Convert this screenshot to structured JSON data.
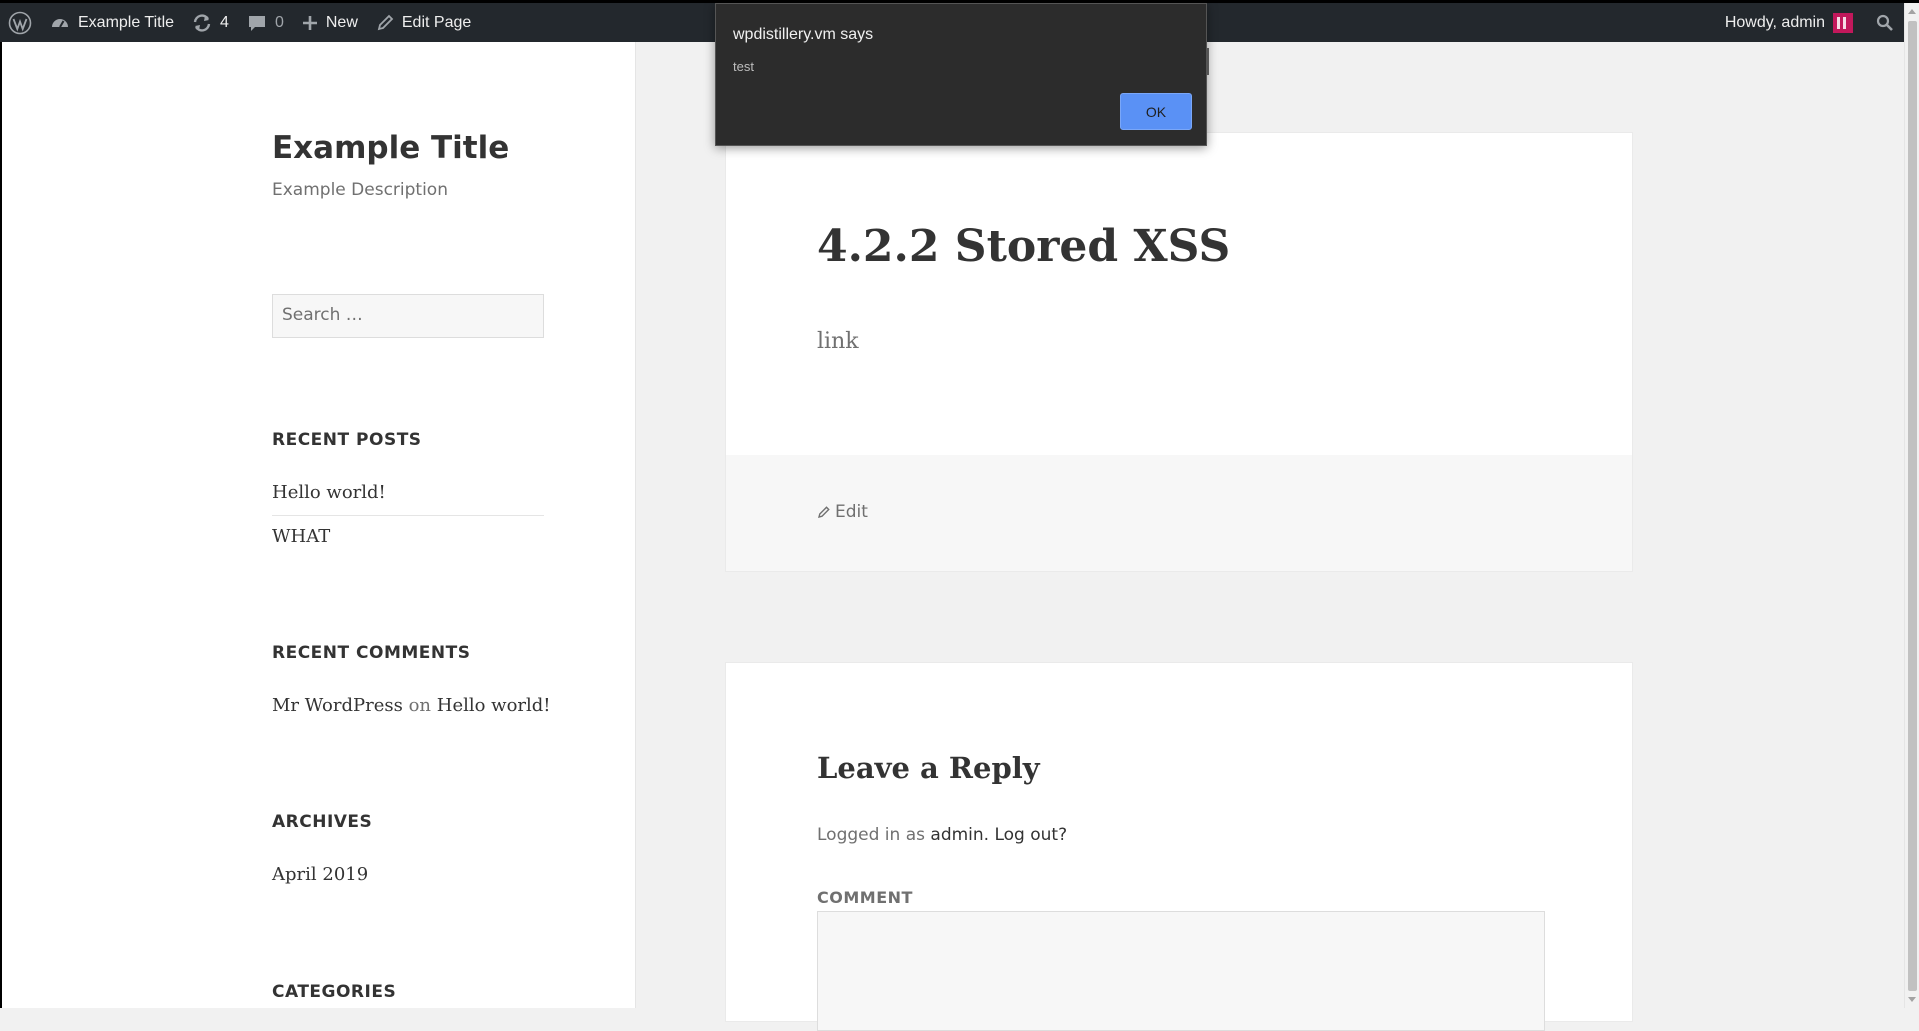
{
  "adminbar": {
    "site_name": "Example Title",
    "updates_count": "4",
    "comments_count": "0",
    "new_label": "New",
    "edit_label": "Edit Page",
    "howdy": "Howdy, admin",
    "icons": [
      "wordpress-logo-icon",
      "dashboard-icon",
      "updates-icon",
      "comment-bubble-icon",
      "plus-icon",
      "pencil-icon",
      "search-icon"
    ]
  },
  "sidebar": {
    "site_title": "Example Title",
    "site_description": "Example Description",
    "search_placeholder": "Search …",
    "recent_posts": {
      "title": "RECENT POSTS",
      "items": [
        "Hello world!",
        "WHAT"
      ]
    },
    "recent_comments": {
      "title": "RECENT COMMENTS",
      "author": "Mr WordPress",
      "on": "on",
      "post": "Hello world!"
    },
    "archives": {
      "title": "ARCHIVES",
      "items": [
        "April 2019"
      ]
    },
    "categories": {
      "title": "CATEGORIES"
    }
  },
  "post": {
    "title": "4.2.2 Stored XSS",
    "body": "link",
    "edit_label": "Edit"
  },
  "reply": {
    "title": "Leave a Reply",
    "logged_in_prefix": "Logged in as",
    "user": "admin.",
    "logout": "Log out?",
    "comment_label": "COMMENT"
  },
  "dialog": {
    "title": "wpdistillery.vm says",
    "message": "test",
    "ok_label": "OK"
  },
  "colors": {
    "adminbar_bg": "#23282d",
    "dialog_bg": "#2c2c2c",
    "ok_button": "#5a91f5",
    "page_bg": "#f1f1f1"
  }
}
